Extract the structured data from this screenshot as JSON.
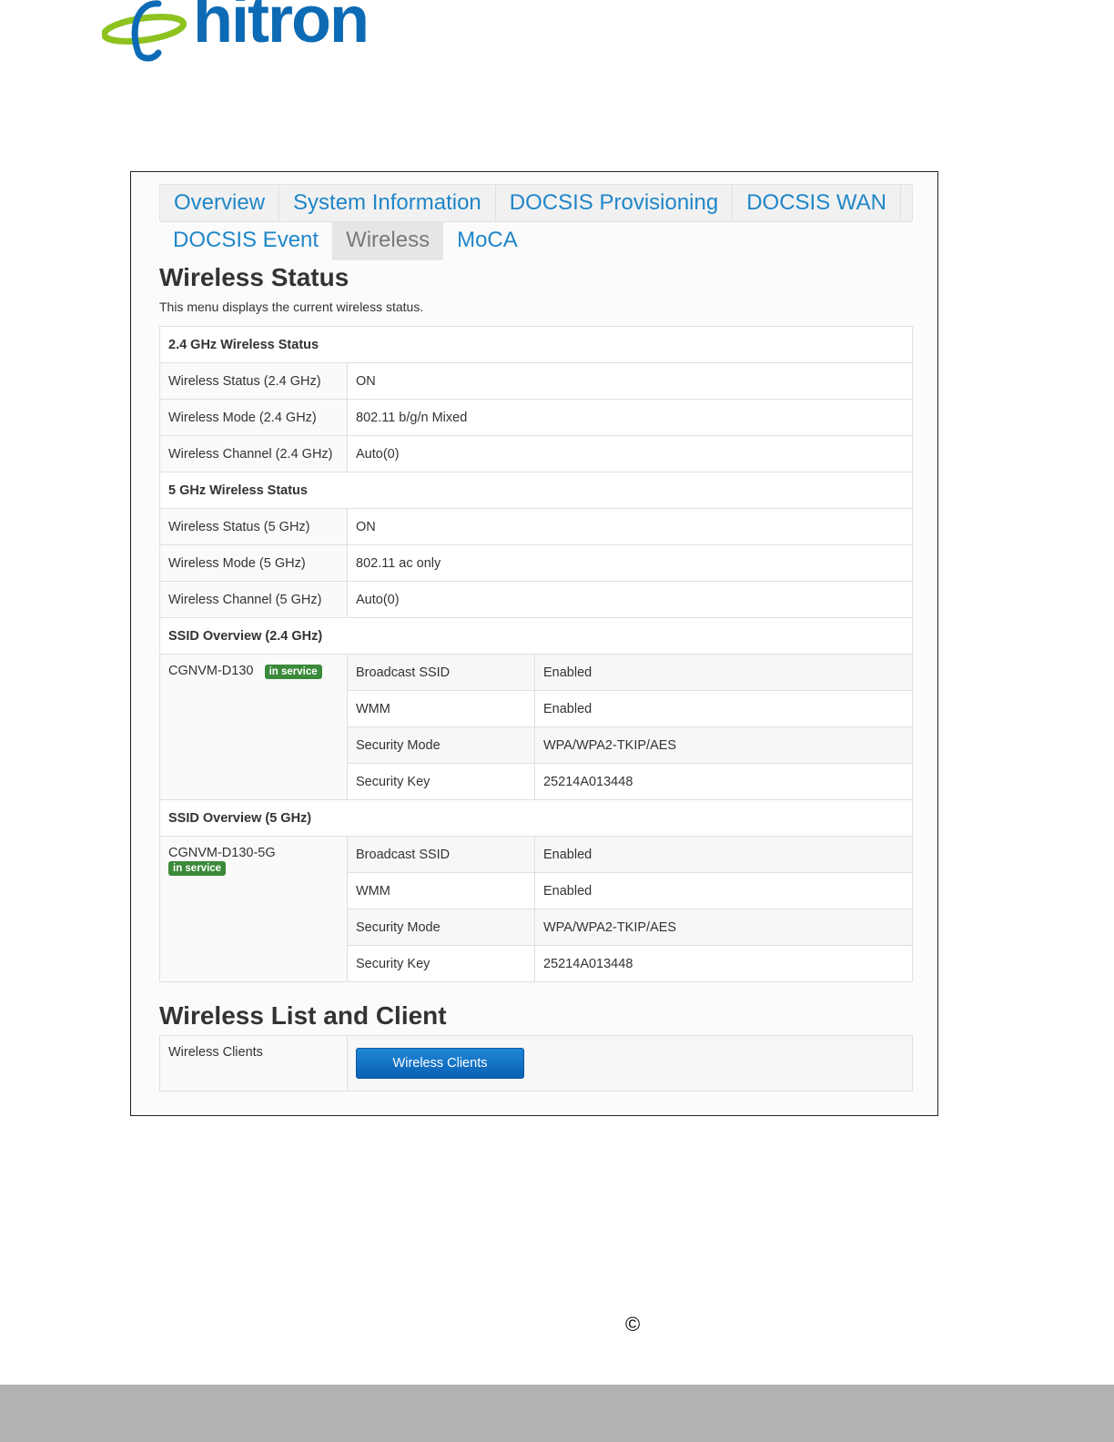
{
  "brand": {
    "name": "hitron",
    "color": "#0d6bb5",
    "accent": "#8dc21f"
  },
  "tabs_row1": [
    "Overview",
    "System Information",
    "DOCSIS Provisioning",
    "DOCSIS WAN"
  ],
  "tabs_row2": [
    "DOCSIS Event",
    "Wireless",
    "MoCA"
  ],
  "active_tab": "Wireless",
  "wireless_status": {
    "title": "Wireless Status",
    "description": "This menu displays the current wireless status.",
    "band24": {
      "header": "2.4 GHz Wireless Status",
      "rows": [
        {
          "label": "Wireless Status (2.4 GHz)",
          "value": "ON"
        },
        {
          "label": "Wireless Mode (2.4 GHz)",
          "value": "802.11 b/g/n Mixed"
        },
        {
          "label": "Wireless Channel (2.4 GHz)",
          "value": "Auto(0)"
        }
      ]
    },
    "band5": {
      "header": "5 GHz Wireless Status",
      "rows": [
        {
          "label": "Wireless Status (5 GHz)",
          "value": "ON"
        },
        {
          "label": "Wireless Mode (5 GHz)",
          "value": "802.11 ac only"
        },
        {
          "label": "Wireless Channel (5 GHz)",
          "value": "Auto(0)"
        }
      ]
    },
    "ssid24": {
      "header": "SSID Overview (2.4 GHz)",
      "name": "CGNVM-D130",
      "badge": "in service",
      "rows": [
        {
          "label": "Broadcast SSID",
          "value": "Enabled"
        },
        {
          "label": "WMM",
          "value": "Enabled"
        },
        {
          "label": "Security Mode",
          "value": "WPA/WPA2-TKIP/AES"
        },
        {
          "label": "Security Key",
          "value": "25214A013448"
        }
      ]
    },
    "ssid5": {
      "header": "SSID Overview (5 GHz)",
      "name": "CGNVM-D130-5G",
      "badge": "in service",
      "rows": [
        {
          "label": "Broadcast SSID",
          "value": "Enabled"
        },
        {
          "label": "WMM",
          "value": "Enabled"
        },
        {
          "label": "Security Mode",
          "value": "WPA/WPA2-TKIP/AES"
        },
        {
          "label": "Security Key",
          "value": "25214A013448"
        }
      ]
    }
  },
  "wireless_list": {
    "title": "Wireless List and Client",
    "label": "Wireless Clients",
    "button": "Wireless Clients"
  },
  "footer": {
    "copyright_symbol": "©"
  }
}
